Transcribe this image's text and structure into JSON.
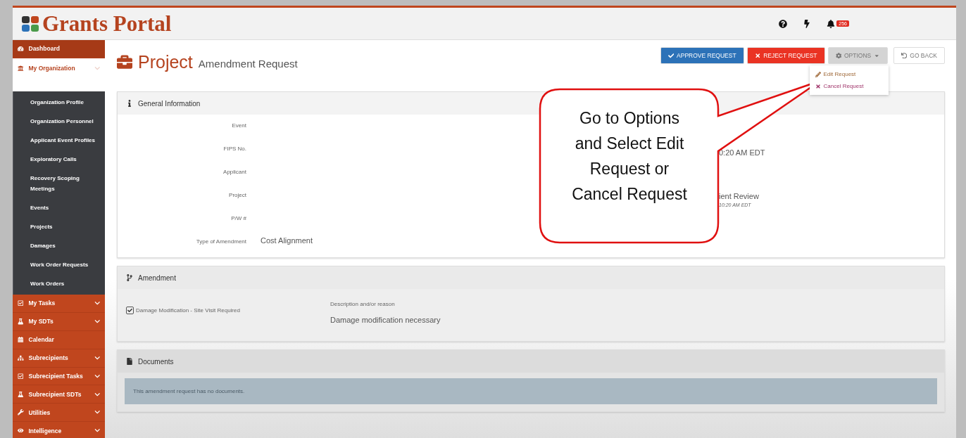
{
  "header": {
    "logo": "Grants Portal",
    "notification_count": "256"
  },
  "sidebar": {
    "items": [
      {
        "label": "Dashboard",
        "kind": "link",
        "selected": true,
        "expanded": false
      },
      {
        "label": "My Organization",
        "kind": "group",
        "selected": false,
        "expanded": true,
        "children": [
          {
            "label": "Organization Profile",
            "selected": false
          },
          {
            "label": "Organization Personnel",
            "selected": false
          },
          {
            "label": "Applicant Event Profiles",
            "selected": false
          },
          {
            "label": "Exploratory Calls",
            "selected": false
          },
          {
            "label": "Recovery Scoping Meetings",
            "selected": false
          },
          {
            "label": "Events",
            "selected": false
          },
          {
            "label": "Projects",
            "selected": false
          },
          {
            "label": "Damages",
            "selected": false
          },
          {
            "label": "Work Order Requests",
            "selected": false
          },
          {
            "label": "Work Orders",
            "selected": false
          }
        ]
      },
      {
        "label": "My Tasks",
        "kind": "group",
        "selected": false,
        "expanded": false
      },
      {
        "label": "My SDTs",
        "kind": "group",
        "selected": false,
        "expanded": false
      },
      {
        "label": "Calendar",
        "kind": "link",
        "selected": false,
        "expanded": false
      },
      {
        "label": "Subrecipients",
        "kind": "group",
        "selected": false,
        "expanded": false
      },
      {
        "label": "Subrecipient Tasks",
        "kind": "group",
        "selected": false,
        "expanded": false
      },
      {
        "label": "Subrecipient SDTs",
        "kind": "group",
        "selected": false,
        "expanded": false
      },
      {
        "label": "Utilities",
        "kind": "group",
        "selected": false,
        "expanded": false
      },
      {
        "label": "Intelligence",
        "kind": "group",
        "selected": false,
        "expanded": false
      }
    ]
  },
  "page": {
    "title": "Project",
    "subtitle": "Amendment Request"
  },
  "actions": [
    {
      "label": "APPROVE REQUEST",
      "kind": "approve"
    },
    {
      "label": "REJECT REQUEST",
      "kind": "reject"
    },
    {
      "label": "OPTIONS",
      "kind": "options"
    },
    {
      "label": "GO BACK",
      "kind": "back"
    }
  ],
  "options_menu": {
    "open": true,
    "items": [
      {
        "label": "Edit Request",
        "kind": "edit"
      },
      {
        "label": "Cancel Request",
        "kind": "cancel"
      }
    ]
  },
  "general_information": {
    "title": "General Information",
    "fields": [
      {
        "label": "Event"
      },
      {
        "label": "FIPS No."
      },
      {
        "label": "Applicant"
      },
      {
        "label": "Project"
      },
      {
        "label": "P/W #"
      },
      {
        "label": "Type of Amendment",
        "value": "Cost Alignment"
      }
    ],
    "right_fields": [
      {
        "value": "0:20 AM EDT"
      },
      {
        "value": "ient Review",
        "note": "10:20 AM EDT"
      }
    ]
  },
  "amendment": {
    "title": "Amendment",
    "option": {
      "label": "Damage Modification - Site Visit Required",
      "checked": true
    },
    "description_label": "Description and/or reason",
    "description": "Damage modification necessary"
  },
  "documents": {
    "title": "Documents",
    "message": "This amendment request has no documents."
  },
  "callout": {
    "text": "Go to Options and Select Edit Request or Cancel Request"
  }
}
